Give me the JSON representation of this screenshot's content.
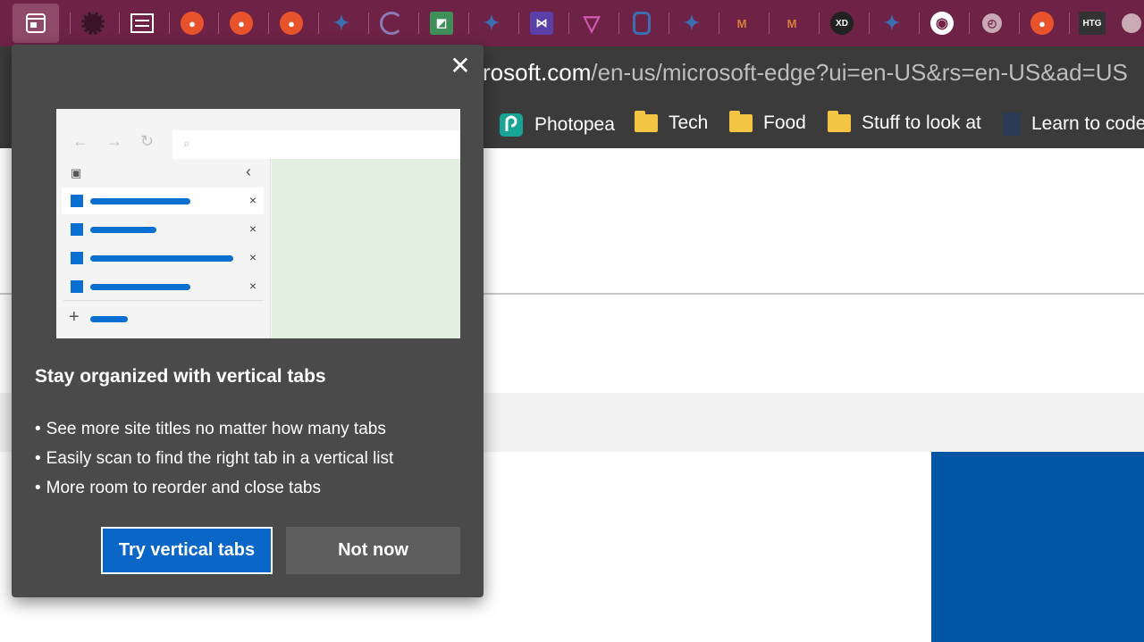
{
  "tabstrip": {
    "tabs": [
      {
        "icon": "vertical-tabs-icon",
        "label": ""
      },
      {
        "icon": "gear-favicon",
        "label": ""
      },
      {
        "icon": "media-favicon",
        "label": ""
      },
      {
        "icon": "reddit-favicon",
        "label": ""
      },
      {
        "icon": "reddit-favicon",
        "label": ""
      },
      {
        "icon": "reddit-favicon",
        "label": ""
      },
      {
        "icon": "twitter-favicon",
        "label": ""
      },
      {
        "icon": "refresh-favicon",
        "label": ""
      },
      {
        "icon": "maps-favicon",
        "label": ""
      },
      {
        "icon": "twitter-favicon",
        "label": ""
      },
      {
        "icon": "visual-studio-favicon",
        "label": ""
      },
      {
        "icon": "triangle-favicon",
        "label": ""
      },
      {
        "icon": "bitwarden-favicon",
        "label": ""
      },
      {
        "icon": "twitter-favicon",
        "label": ""
      },
      {
        "icon": "m-favicon",
        "label": "M"
      },
      {
        "icon": "m-favicon",
        "label": "M"
      },
      {
        "icon": "xd-favicon",
        "label": "XD"
      },
      {
        "icon": "twitter-favicon",
        "label": ""
      },
      {
        "icon": "github-favicon",
        "label": ""
      },
      {
        "icon": "clock-favicon",
        "label": ""
      },
      {
        "icon": "reddit-favicon",
        "label": ""
      },
      {
        "icon": "htg-favicon",
        "label": "HTG"
      }
    ]
  },
  "address_bar": {
    "domain": "rosoft.com",
    "path": "/en-us/microsoft-edge?ui=en-US&rs=en-US&ad=US"
  },
  "favorites": [
    {
      "label": "Photopea",
      "icon": "photopea-icon"
    },
    {
      "label": "Tech",
      "icon": "folder-icon"
    },
    {
      "label": "Food",
      "icon": "folder-icon"
    },
    {
      "label": "Stuff to look at",
      "icon": "folder-icon"
    },
    {
      "label": "Learn to code",
      "icon": "page-icon"
    }
  ],
  "popup": {
    "title": "Stay organized with vertical tabs",
    "bullets": [
      "See more site titles no matter how many tabs",
      "Easily scan to find the right tab in a vertical list",
      "More room to reorder and close tabs"
    ],
    "primary_button": "Try vertical tabs",
    "secondary_button": "Not now",
    "close_glyph": "✕"
  },
  "colors": {
    "tabstrip": "#6e2346",
    "popup_bg": "#4a4a4a",
    "primary": "#0a67c8",
    "page_blue": "#0055a5"
  }
}
